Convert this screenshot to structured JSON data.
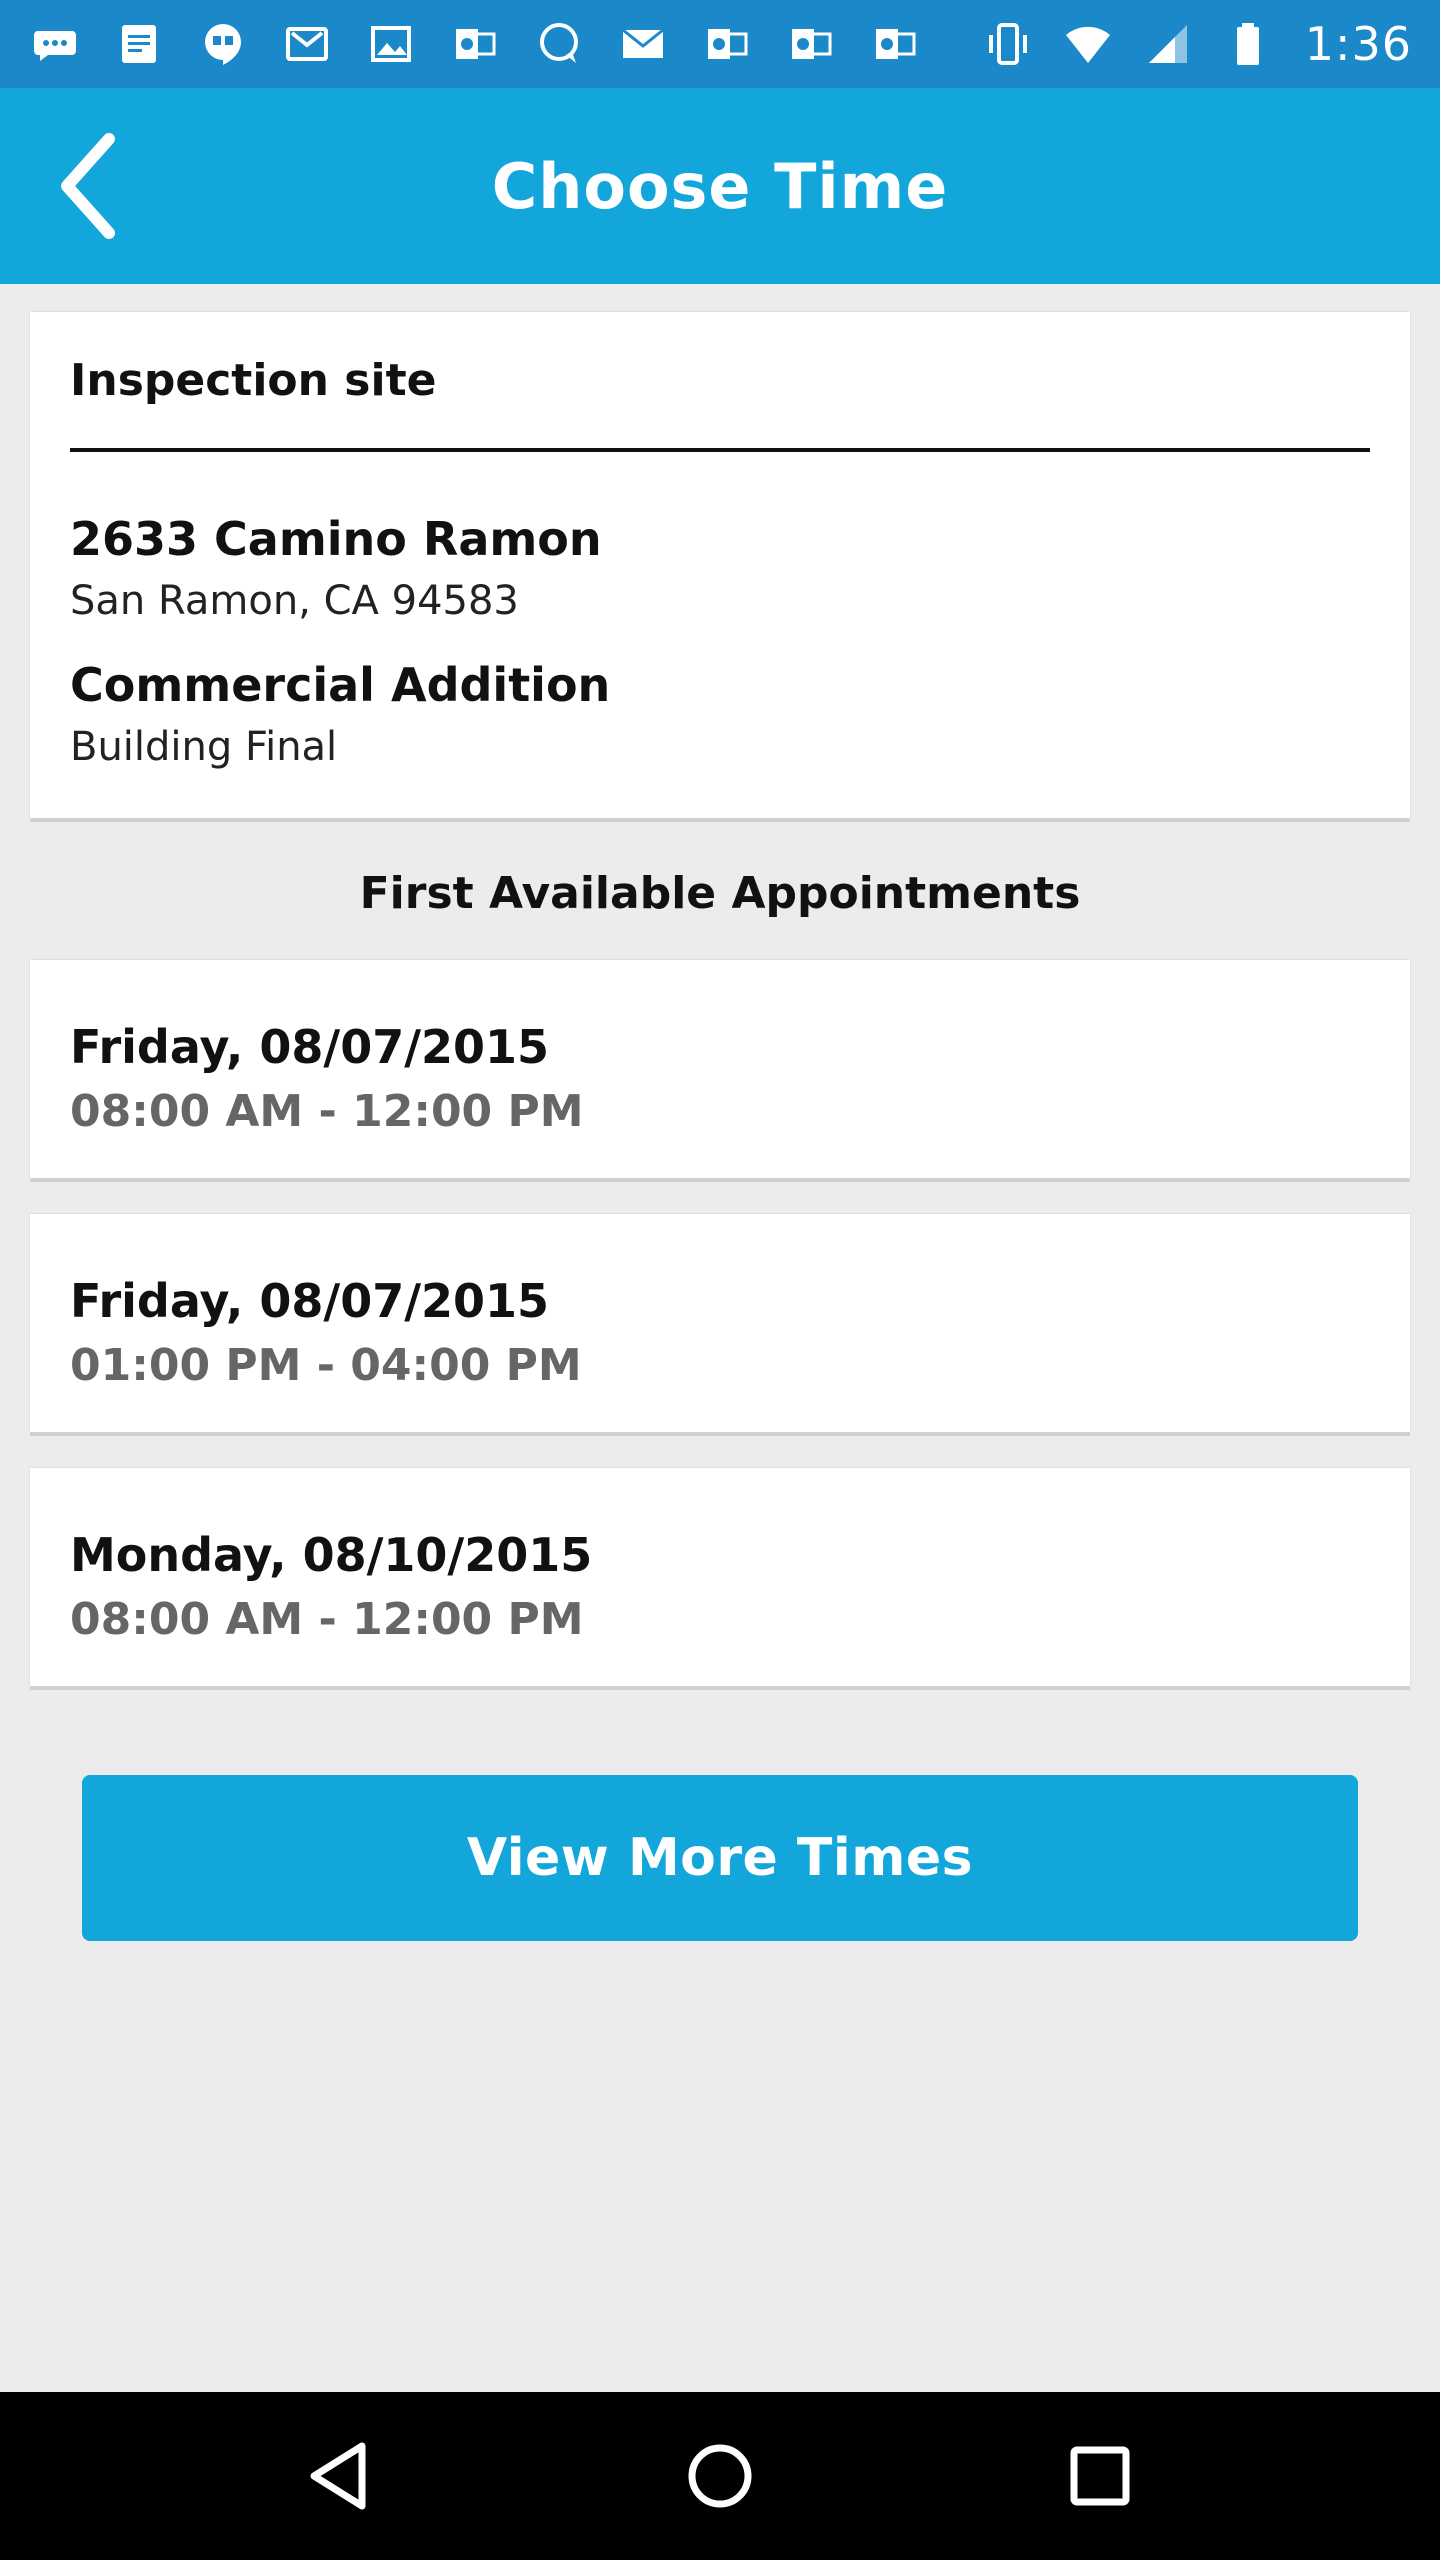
{
  "status_bar": {
    "time": "1:36",
    "left_icons": [
      "chat-bubble-icon",
      "docs-icon",
      "hangouts-icon",
      "gmail-icon",
      "photos-icon",
      "outlook-icon",
      "messenger-icon",
      "email-icon",
      "outlook-icon",
      "outlook-icon",
      "outlook-icon"
    ],
    "right_icons": [
      "vibrate-icon",
      "wifi-icon",
      "signal-icon",
      "battery-icon"
    ]
  },
  "app_bar": {
    "title": "Choose Time",
    "back_icon": "chevron-left-icon"
  },
  "inspection_site": {
    "header": "Inspection site",
    "address_line1": "2633 Camino Ramon",
    "address_line2": "San Ramon, CA 94583",
    "permit_type": "Commercial Addition",
    "inspection_type": "Building Final"
  },
  "appointments": {
    "section_title": "First Available Appointments",
    "items": [
      {
        "date": "Friday, 08/07/2015",
        "time": "08:00 AM - 12:00 PM"
      },
      {
        "date": "Friday, 08/07/2015",
        "time": "01:00 PM - 04:00 PM"
      },
      {
        "date": "Monday, 08/10/2015",
        "time": "08:00 AM - 12:00 PM"
      }
    ]
  },
  "actions": {
    "view_more_label": "View More Times"
  },
  "nav_bar": {
    "back": "nav-back-icon",
    "home": "nav-home-icon",
    "recents": "nav-recents-icon"
  },
  "colors": {
    "status_bar": "#1a88c9",
    "primary": "#12a6db",
    "background": "#ececec"
  }
}
